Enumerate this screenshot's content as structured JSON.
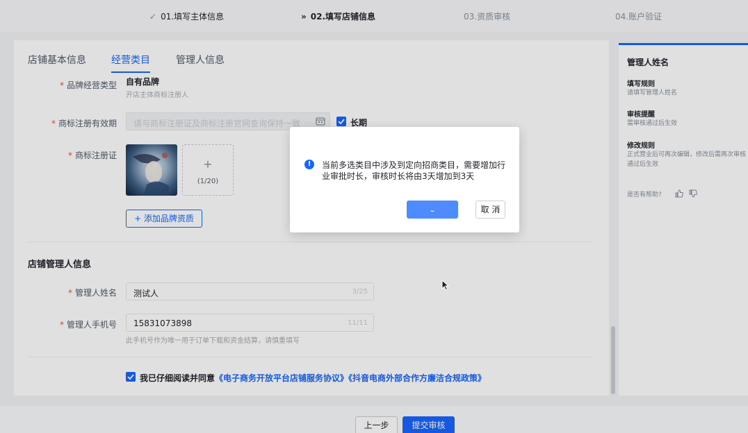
{
  "steps": [
    {
      "mark": "✓",
      "label": "01.填写主体信息"
    },
    {
      "mark": "»",
      "label": "02.填写店铺信息"
    },
    {
      "label": "03.资质审核"
    },
    {
      "label": "04.账户验证"
    }
  ],
  "tabs": [
    "店铺基本信息",
    "经营类目",
    "管理人信息"
  ],
  "brand_type": {
    "label": "品牌经营类型",
    "value": "自有品牌",
    "hint": "开店主体商标注册人"
  },
  "trademark_validity": {
    "label": "商标注册有效期",
    "placeholder": "请与商标注册证及商标注册官网查询保持一致",
    "long_term_label": "长期",
    "long_term_checked": true
  },
  "trademark_cert": {
    "label": "商标注册证",
    "upload_plus": "+",
    "upload_count": "(1/20)"
  },
  "add_brand_button": "+ 添加品牌资质",
  "manager_section": {
    "title": "店铺管理人信息",
    "name_label": "管理人姓名",
    "name_value": "测试人",
    "name_count": "3/25",
    "phone_label": "管理人手机号",
    "phone_value": "15831073898",
    "phone_count": "11/11",
    "phone_hint": "此手机号作为唯一用于订单下载和资金结算，请慎重填写"
  },
  "agreement": {
    "checked": true,
    "prefix": "我已仔细阅读并同意",
    "link1": "《电子商务开放平台店铺服务协议》",
    "link2": "《抖音电商外部合作方廉洁合规政策》"
  },
  "side_panel": {
    "title": "管理人姓名",
    "sections": [
      {
        "heading": "填写规则",
        "text": "请填写管理人姓名"
      },
      {
        "heading": "审核提醒",
        "text": "需审核通过后生效"
      },
      {
        "heading": "修改规则",
        "text": "正式营业后可再次编辑，修改后需再次审核通过后生效"
      }
    ],
    "help": "是否有帮助?"
  },
  "footer": {
    "prev": "上一步",
    "submit": "提交审核"
  },
  "modal": {
    "icon": "!",
    "message": "当前多选类目中涉及到定向招商类目，需要增加行业审批时长，审核时长将由3天增加到3天",
    "cancel": "取 消"
  },
  "colors": {
    "brand": "#1966ff",
    "required": "#f54a45"
  }
}
